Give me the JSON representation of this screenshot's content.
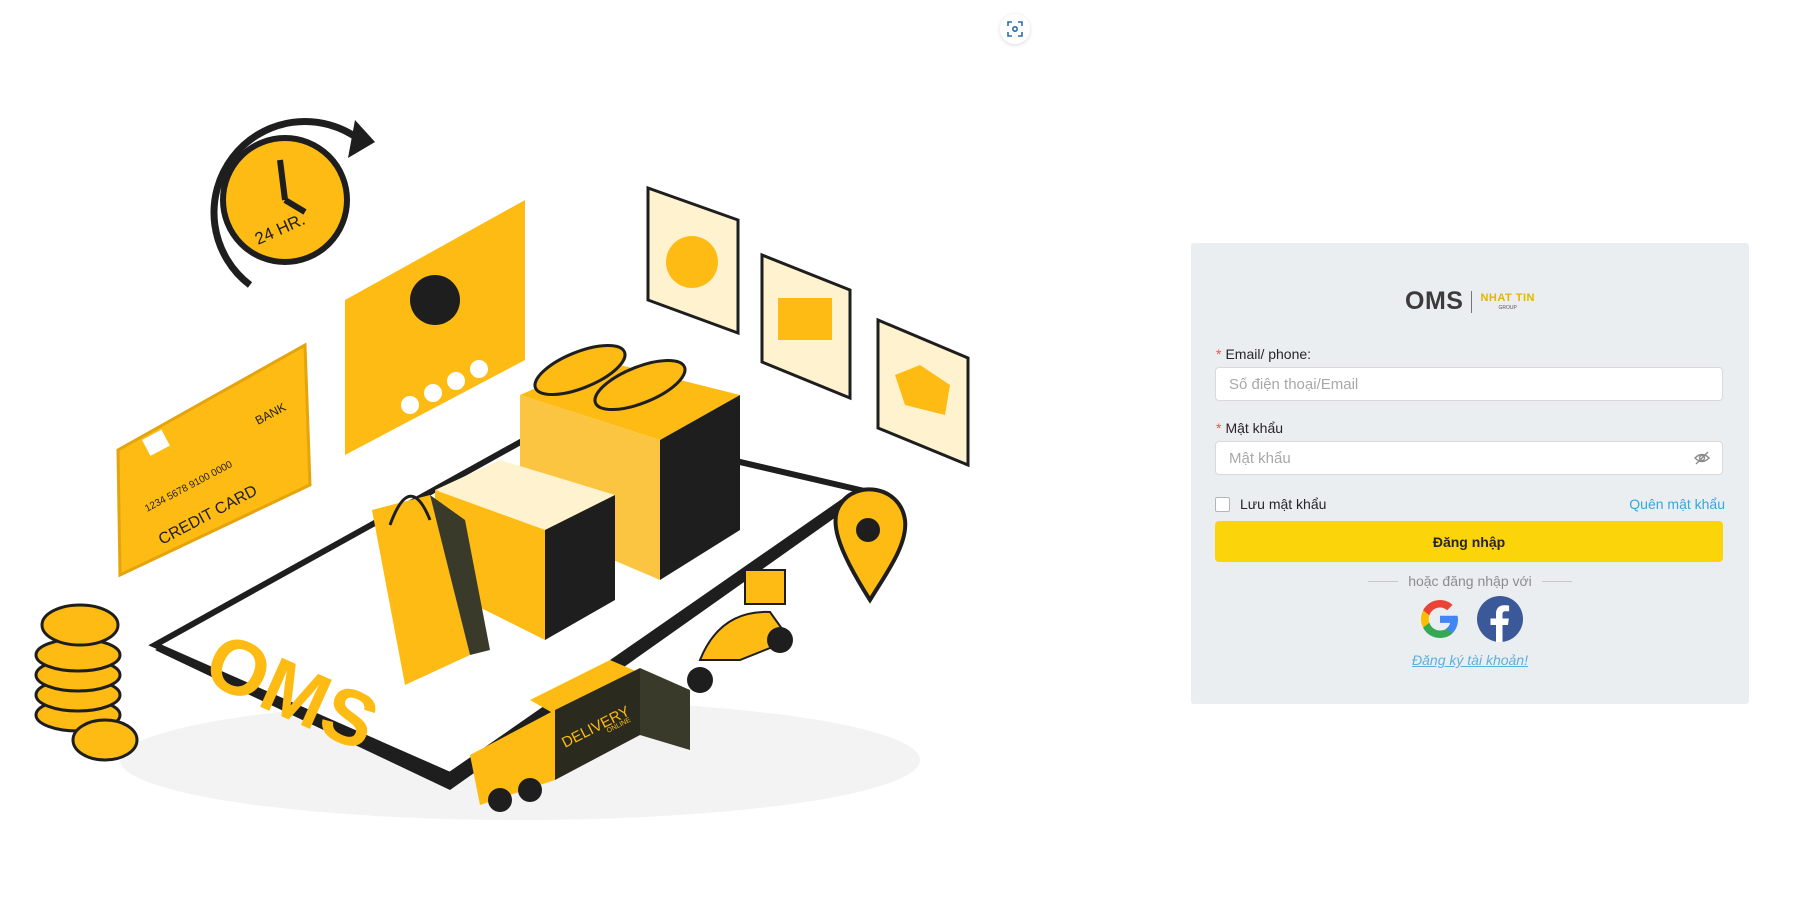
{
  "brand": {
    "name": "OMS",
    "sub": "NHAT TIN",
    "group": "GROUP"
  },
  "illustration": {
    "clock_text": "24 HR.",
    "card_bank": "BANK",
    "card_number": "1234 5678 9100 0000",
    "card_label": "CREDIT CARD",
    "phone_logo": "OMS",
    "truck_text": "DELIVERY",
    "truck_sub": "ONLINE"
  },
  "form": {
    "email_label": "Email/ phone:",
    "email_placeholder": "Số điện thoại/Email",
    "password_label": "Mật khẩu",
    "password_placeholder": "Mật khẩu",
    "remember_label": "Lưu mật khẩu",
    "forgot_label": "Quên mật khẩu",
    "login_button": "Đăng nhập",
    "or_login_with": "hoặc đăng nhập với",
    "register_link": "Đăng ký tài khoản!",
    "required_mark": "*"
  },
  "icons": [
    "focus-icon",
    "eye-off-icon",
    "google-icon",
    "facebook-icon"
  ],
  "colors": {
    "accent": "#fbd50a",
    "link": "#34a6e0",
    "card_bg": "#ebeef1",
    "illustration_yellow": "#fdbb13"
  }
}
